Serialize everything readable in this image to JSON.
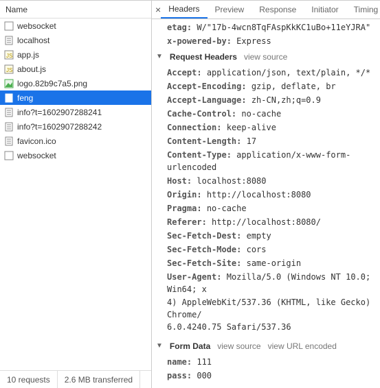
{
  "left": {
    "header": "Name",
    "items": [
      {
        "name": "websocket",
        "type": "ws",
        "selected": false
      },
      {
        "name": "localhost",
        "type": "doc",
        "selected": false
      },
      {
        "name": "app.js",
        "type": "js",
        "selected": false
      },
      {
        "name": "about.js",
        "type": "js",
        "selected": false
      },
      {
        "name": "logo.82b9c7a5.png",
        "type": "img",
        "selected": false
      },
      {
        "name": "feng",
        "type": "doc",
        "selected": true
      },
      {
        "name": "info?t=1602907288241",
        "type": "doc",
        "selected": false
      },
      {
        "name": "info?t=1602907288242",
        "type": "doc",
        "selected": false
      },
      {
        "name": "favicon.ico",
        "type": "doc",
        "selected": false
      },
      {
        "name": "websocket",
        "type": "ws",
        "selected": false
      }
    ],
    "footer": {
      "requests": "10 requests",
      "transferred": "2.6 MB transferred"
    }
  },
  "tabs": {
    "close": "×",
    "items": [
      {
        "label": "Headers",
        "active": true
      },
      {
        "label": "Preview",
        "active": false
      },
      {
        "label": "Response",
        "active": false
      },
      {
        "label": "Initiator",
        "active": false
      },
      {
        "label": "Timing",
        "active": false
      }
    ]
  },
  "top_headers": [
    {
      "k": "etag:",
      "v": "W/\"17b-4wcn8TqFAspKkKC1uBo+11eYJRA\""
    },
    {
      "k": "x-powered-by:",
      "v": "Express"
    }
  ],
  "request_headers": {
    "title": "Request Headers",
    "link": "view source",
    "items": [
      {
        "k": "Accept:",
        "v": "application/json, text/plain, */*"
      },
      {
        "k": "Accept-Encoding:",
        "v": "gzip, deflate, br"
      },
      {
        "k": "Accept-Language:",
        "v": "zh-CN,zh;q=0.9"
      },
      {
        "k": "Cache-Control:",
        "v": "no-cache"
      },
      {
        "k": "Connection:",
        "v": "keep-alive"
      },
      {
        "k": "Content-Length:",
        "v": "17"
      },
      {
        "k": "Content-Type:",
        "v": "application/x-www-form-urlencoded"
      },
      {
        "k": "Host:",
        "v": "localhost:8080"
      },
      {
        "k": "Origin:",
        "v": "http://localhost:8080"
      },
      {
        "k": "Pragma:",
        "v": "no-cache"
      },
      {
        "k": "Referer:",
        "v": "http://localhost:8080/"
      },
      {
        "k": "Sec-Fetch-Dest:",
        "v": "empty"
      },
      {
        "k": "Sec-Fetch-Mode:",
        "v": "cors"
      },
      {
        "k": "Sec-Fetch-Site:",
        "v": "same-origin"
      }
    ],
    "user_agent": {
      "k": "User-Agent:",
      "lines": [
        "Mozilla/5.0 (Windows NT 10.0; Win64; x",
        "4) AppleWebKit/537.36 (KHTML, like Gecko) Chrome/",
        "6.0.4240.75 Safari/537.36"
      ]
    }
  },
  "form_data": {
    "title": "Form Data",
    "link1": "view source",
    "link2": "view URL encoded",
    "items": [
      {
        "k": "name:",
        "v": "111"
      },
      {
        "k": "pass:",
        "v": "000"
      }
    ]
  }
}
